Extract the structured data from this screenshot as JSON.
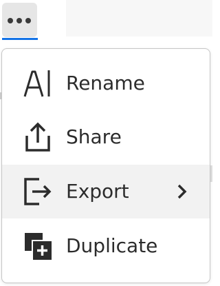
{
  "topbar": {
    "more_button_label": "More options"
  },
  "menu": {
    "items": [
      {
        "label": "Rename",
        "icon": "rename-icon",
        "highlighted": false,
        "has_submenu": false
      },
      {
        "label": "Share",
        "icon": "share-icon",
        "highlighted": false,
        "has_submenu": false
      },
      {
        "label": "Export",
        "icon": "export-icon",
        "highlighted": true,
        "has_submenu": true
      },
      {
        "label": "Duplicate",
        "icon": "duplicate-icon",
        "highlighted": false,
        "has_submenu": false
      }
    ]
  },
  "colors": {
    "accent": "#1473e6",
    "text": "#2c2c2c",
    "highlight_bg": "#f2f2f2",
    "menu_border": "#c6c6c6"
  }
}
